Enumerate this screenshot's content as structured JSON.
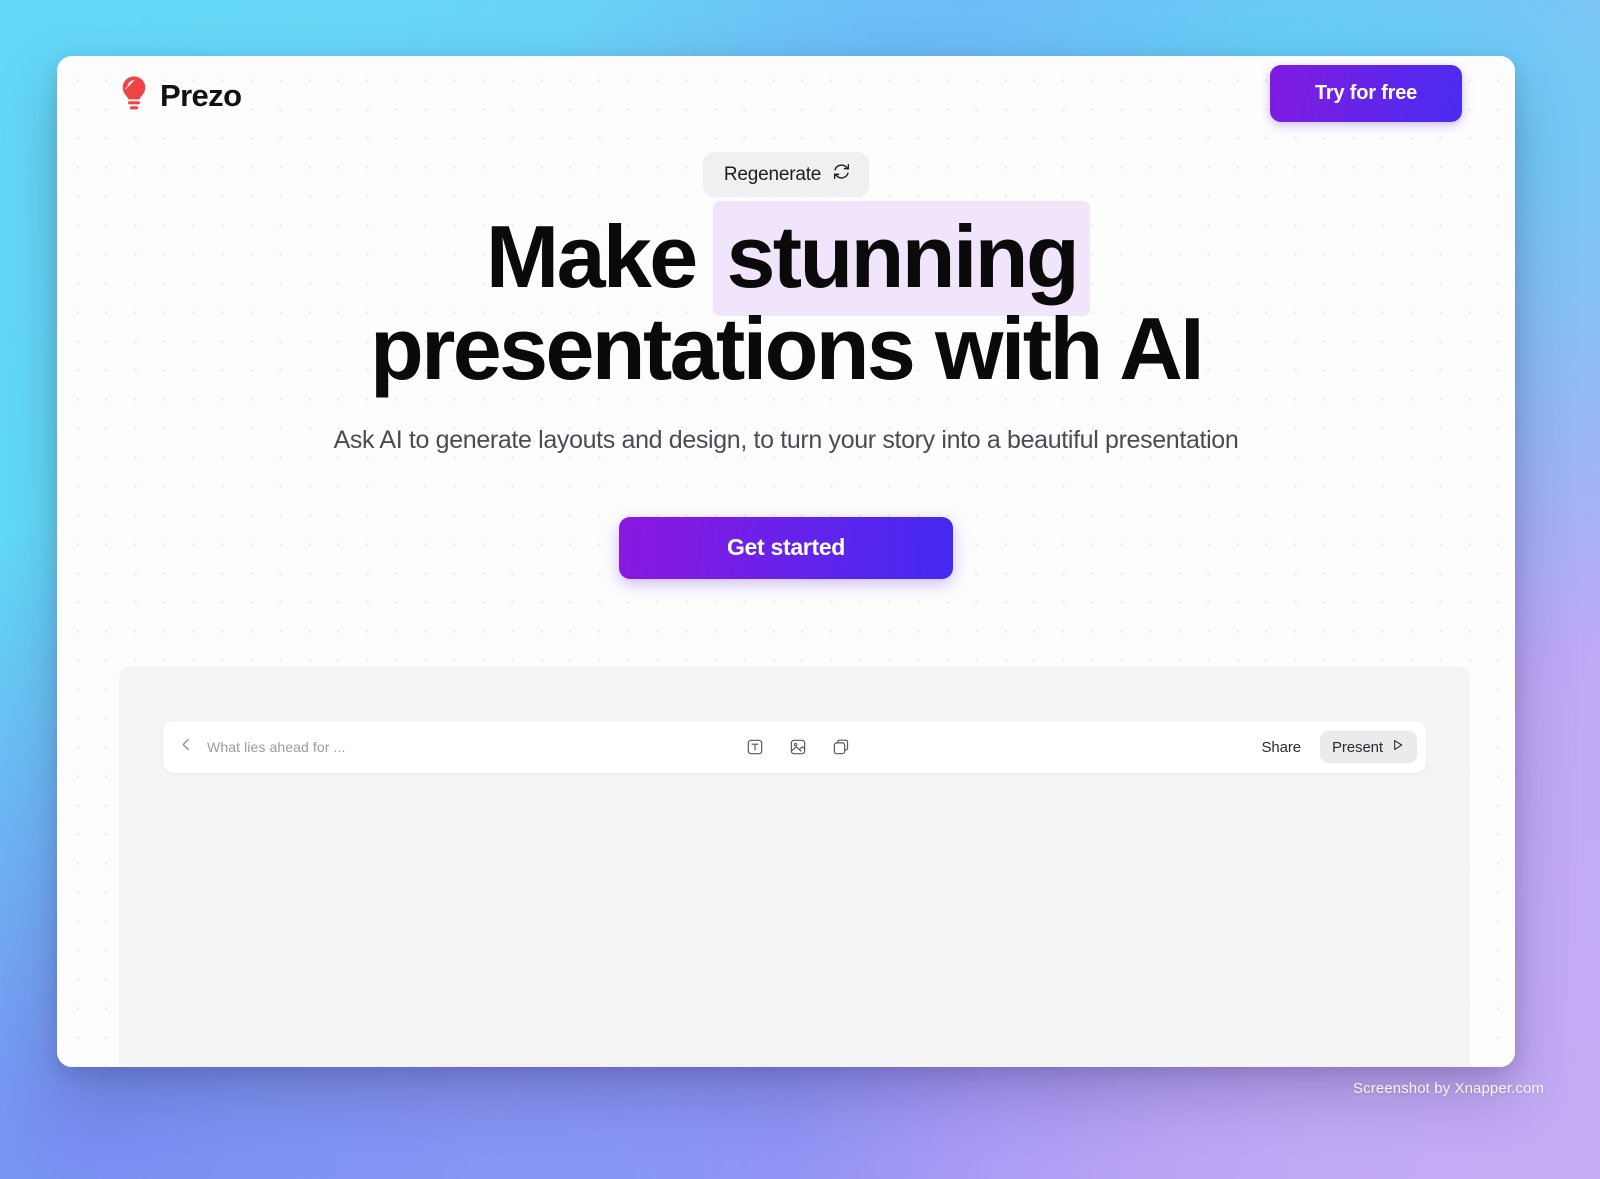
{
  "window": {
    "brand_name": "Prezo",
    "logo_icon": "lightbulb-icon",
    "try_free_label": "Try for free"
  },
  "hero": {
    "regenerate_label": "Regenerate",
    "regenerate_icon": "refresh-cycle-icon",
    "headline_part1": "Make ",
    "headline_highlight": "stunning",
    "headline_part2": "presentations with AI",
    "subheadline": "Ask AI to generate layouts and design, to turn your story into a beautiful presentation",
    "cta_label": "Get started"
  },
  "editor": {
    "back_icon": "chevron-left-icon",
    "slide_title": "What lies ahead for ...",
    "tools": [
      {
        "name": "text-box-icon",
        "label": "Text"
      },
      {
        "name": "image-icon",
        "label": "Image"
      },
      {
        "name": "shapes-icon",
        "label": "Shapes"
      }
    ],
    "share_label": "Share",
    "present_label": "Present",
    "present_icon": "play-triangle-icon"
  },
  "watermark": {
    "text": "Screenshot by Xnapper.com"
  },
  "colors": {
    "accent_purple": "#7d1ce0",
    "accent_blue": "#4329f2",
    "logo_red": "#ef4444",
    "highlight_lavender": "#f1e5fb",
    "panel_gray": "#f4f4f5",
    "wallpaper_cyan": "#5ad4f5",
    "wallpaper_violet": "#8f86ef",
    "wallpaper_lilac": "#bca8f2"
  }
}
